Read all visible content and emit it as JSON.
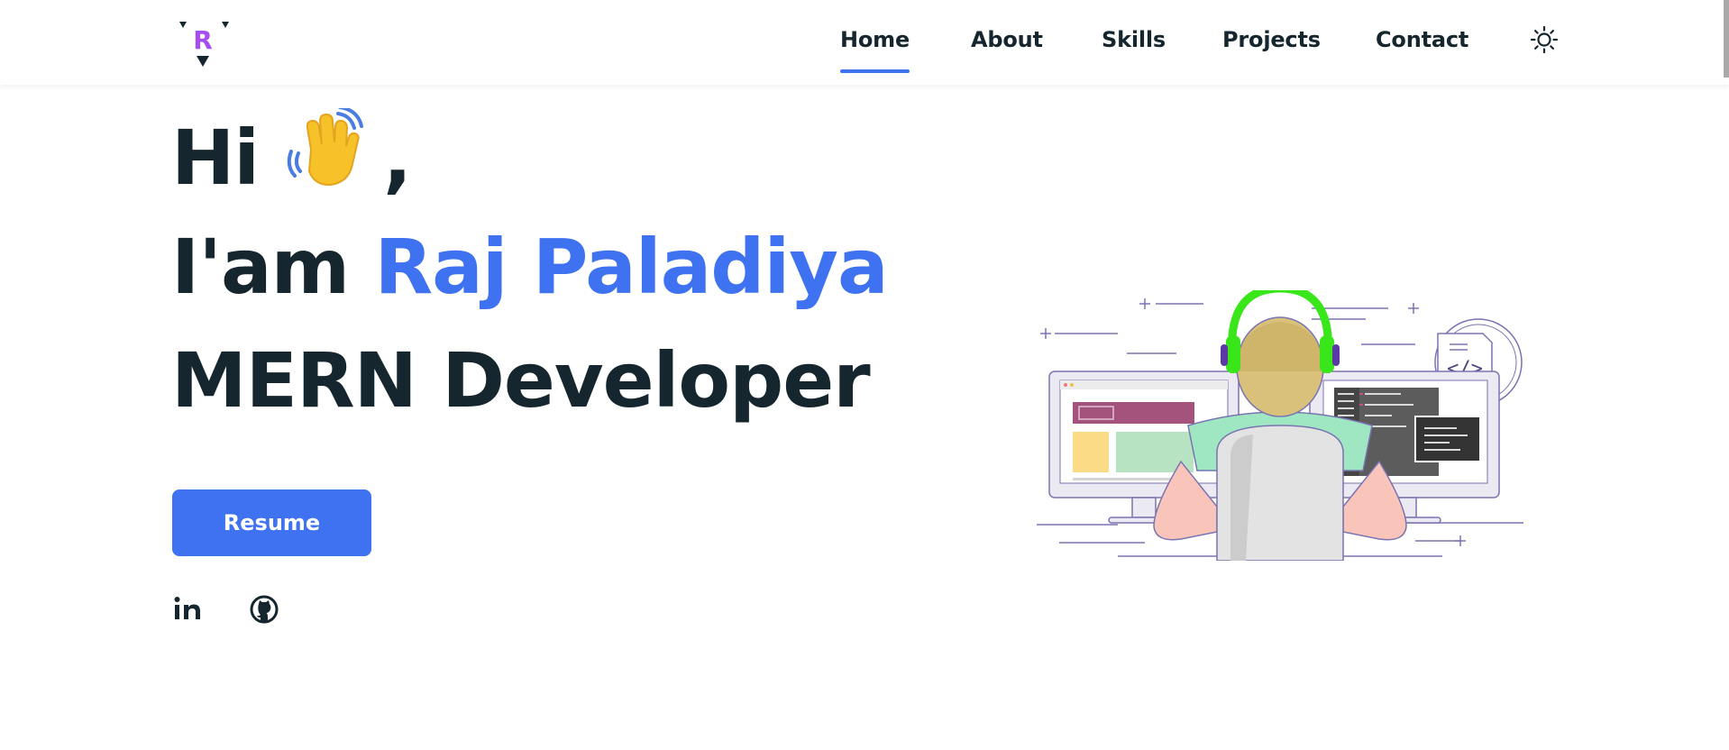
{
  "brand": {
    "logo_letter": "R",
    "logo_color": "#a64df0"
  },
  "nav": {
    "items": [
      {
        "label": "Home",
        "active": true
      },
      {
        "label": "About",
        "active": false
      },
      {
        "label": "Skills",
        "active": false
      },
      {
        "label": "Projects",
        "active": false
      },
      {
        "label": "Contact",
        "active": false
      }
    ],
    "theme_icon": "sun-icon"
  },
  "hero": {
    "greeting": "Hi",
    "comma": ",",
    "wave_icon": "waving-hand-icon",
    "intro_prefix": "I'am",
    "name": "Raj Paladiya",
    "role": "MERN Developer",
    "resume_label": "Resume"
  },
  "social": [
    {
      "icon": "linkedin-icon",
      "label": "in"
    },
    {
      "icon": "github-icon"
    }
  ],
  "colors": {
    "accent": "#3f72f1",
    "text": "#15262f",
    "headphones": "#39e61a"
  }
}
